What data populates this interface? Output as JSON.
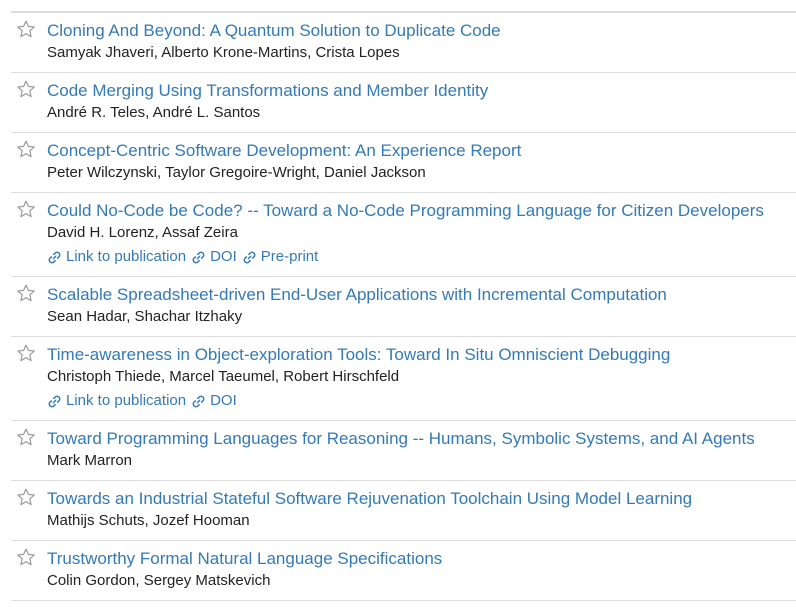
{
  "colors": {
    "link": "#337ab7",
    "text": "#222222",
    "divider": "#dddddd",
    "star": "#999999"
  },
  "icons": {
    "favorite": "star-outline-icon",
    "link": "chain-link-icon"
  },
  "papers": [
    {
      "title": "Cloning And Beyond: A Quantum Solution to Duplicate Code",
      "authors": "Samyak Jhaveri, Alberto Krone-Martins, Crista Lopes",
      "links": []
    },
    {
      "title": "Code Merging Using Transformations and Member Identity",
      "authors": "André R. Teles, André L. Santos",
      "links": []
    },
    {
      "title": "Concept-Centric Software Development: An Experience Report",
      "authors": "Peter Wilczynski, Taylor Gregoire-Wright, Daniel Jackson",
      "links": []
    },
    {
      "title": "Could No-Code be Code? -- Toward a No-Code Programming Language for Citizen Developers",
      "authors": "David H. Lorenz, Assaf Zeira",
      "links": [
        "Link to publication",
        "DOI",
        "Pre-print"
      ]
    },
    {
      "title": "Scalable Spreadsheet-driven End-User Applications with Incremental Computation",
      "authors": "Sean Hadar, Shachar Itzhaky",
      "links": []
    },
    {
      "title": "Time-awareness in Object-exploration Tools: Toward In Situ Omniscient Debugging",
      "authors": "Christoph Thiede, Marcel Taeumel, Robert Hirschfeld",
      "links": [
        "Link to publication",
        "DOI"
      ]
    },
    {
      "title": "Toward Programming Languages for Reasoning -- Humans, Symbolic Systems, and AI Agents",
      "authors": "Mark Marron",
      "links": []
    },
    {
      "title": "Towards an Industrial Stateful Software Rejuvenation Toolchain Using Model Learning",
      "authors": "Mathijs Schuts, Jozef Hooman",
      "links": []
    },
    {
      "title": "Trustworthy Formal Natural Language Specifications",
      "authors": "Colin Gordon, Sergey Matskevich",
      "links": []
    }
  ]
}
